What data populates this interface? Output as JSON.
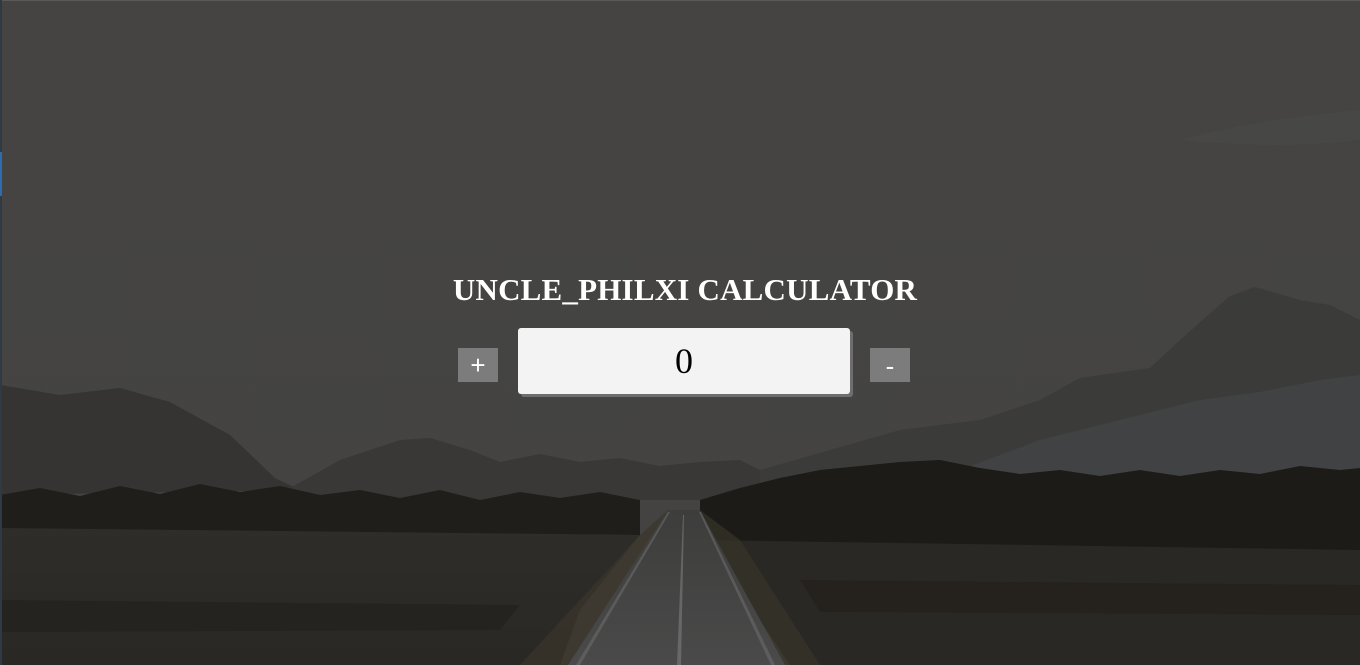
{
  "app": {
    "title": "UNCLE_PHILXI CALCULATOR"
  },
  "counter": {
    "value": "0",
    "increment_label": "+",
    "decrement_label": "-"
  },
  "background": {
    "scene": "dark-dimmed-landscape-road-mountains",
    "overlay_color": "#444342"
  }
}
